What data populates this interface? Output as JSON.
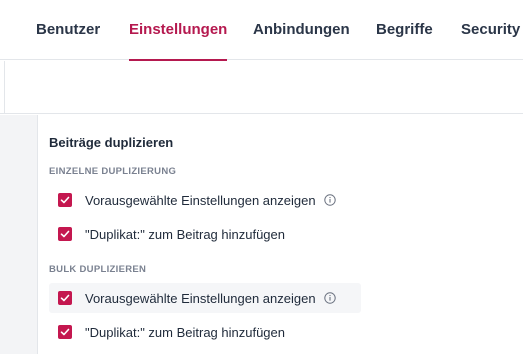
{
  "tabs": [
    {
      "label": "Benutzer",
      "active": false
    },
    {
      "label": "Einstellungen",
      "active": true
    },
    {
      "label": "Anbindungen",
      "active": false
    },
    {
      "label": "Begriffe",
      "active": false
    },
    {
      "label": "Security",
      "active": false
    }
  ],
  "panel": {
    "title": "Beiträge duplizieren",
    "sections": [
      {
        "label": "EINZELNE DUPLIZIERUNG",
        "options": [
          {
            "label": "Vorausgewählte Einstellungen anzeigen",
            "checked": true,
            "info_icon": "info-icon"
          },
          {
            "label": "\"Duplikat:\" zum Beitrag hinzufügen",
            "checked": true
          }
        ]
      },
      {
        "label": "BULK DUPLIZIEREN",
        "options": [
          {
            "label": "Vorausgewählte Einstellungen anzeigen",
            "checked": true,
            "info_icon": "info-icon"
          },
          {
            "label": "\"Duplikat:\" zum Beitrag hinzufügen",
            "checked": true
          }
        ]
      }
    ]
  },
  "colors": {
    "accent": "#b5194f",
    "checkbox": "#c4174f",
    "text": "#1f2a3a",
    "muted": "#7a8190"
  }
}
